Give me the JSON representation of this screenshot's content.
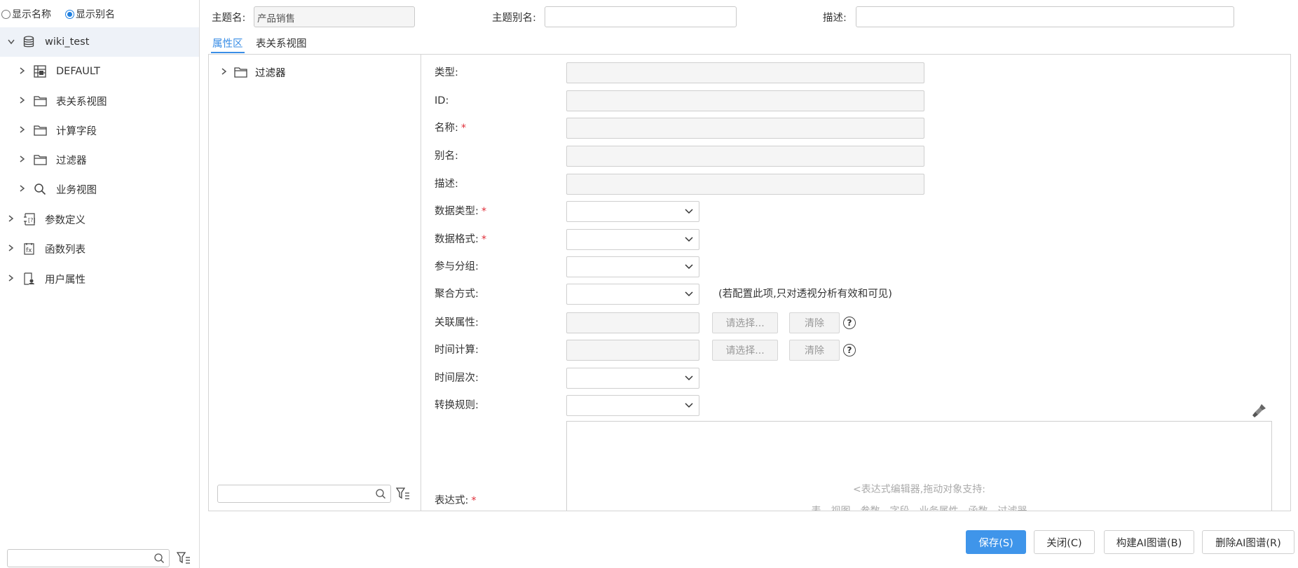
{
  "left": {
    "radio_options": [
      {
        "label": "显示名称",
        "selected": false
      },
      {
        "label": "显示别名",
        "selected": true
      }
    ],
    "tree": [
      {
        "label": "wiki_test",
        "icon": "database-icon",
        "expanded": true
      },
      {
        "label": "DEFAULT",
        "icon": "table-icon"
      },
      {
        "label": "表关系视图",
        "icon": "folder-icon"
      },
      {
        "label": "计算字段",
        "icon": "folder-icon"
      },
      {
        "label": "过滤器",
        "icon": "folder-icon"
      },
      {
        "label": "业务视图",
        "icon": "search-icon"
      },
      {
        "label": "参数定义",
        "icon": "parameter-icon"
      },
      {
        "label": "函数列表",
        "icon": "function-icon"
      },
      {
        "label": "用户属性",
        "icon": "user-property-icon"
      }
    ],
    "search_placeholder": ""
  },
  "header": {
    "topic_name_label": "主题名:",
    "topic_name_value": "产品销售",
    "topic_alias_label": "主题别名:",
    "topic_alias_value": "",
    "description_label": "描述:",
    "description_value": ""
  },
  "tabs": [
    {
      "label": "属性区",
      "active": true
    },
    {
      "label": "表关系视图",
      "active": false
    }
  ],
  "mid_tree": {
    "label": "过滤器",
    "icon": "folder-icon"
  },
  "form": {
    "type_label": "类型:",
    "id_label": "ID:",
    "name_label": "名称:",
    "alias_label": "别名:",
    "desc_label": "描述:",
    "data_type_label": "数据类型:",
    "data_format_label": "数据格式:",
    "group_label": "参与分组:",
    "aggregation_label": "聚合方式:",
    "aggregation_hint": "(若配置此项,只对透视分析有效和可见)",
    "related_attr_label": "关联属性:",
    "time_calc_label": "时间计算:",
    "time_level_label": "时间层次:",
    "convert_rule_label": "转换规则:",
    "expression_label": "表达式:",
    "required_mark": "*",
    "select_button": "请选择...",
    "clear_button": "清除",
    "help_mark": "?",
    "expr_hint_1": "<表达式编辑器,拖动对象支持:",
    "expr_hint_2": "表、视图、参数、字段、业务属性、函数、过滤器"
  },
  "footer": {
    "save": "保存(S)",
    "close": "关闭(C)",
    "build_ai": "构建AI图谱(B)",
    "delete_ai": "删除AI图谱(R)"
  },
  "colors": {
    "accent": "#3f95ea",
    "required": "#e0303b",
    "selected_row": "#eef2f8"
  }
}
